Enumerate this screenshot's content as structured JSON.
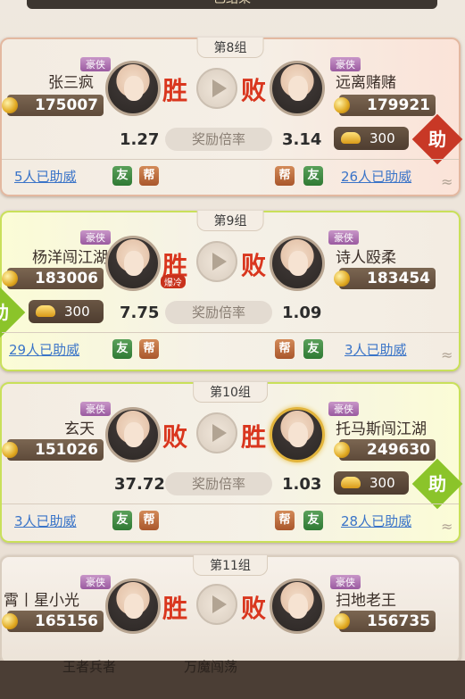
{
  "header": {
    "title": "已结束"
  },
  "common": {
    "rate_label": "奖励倍率",
    "friend_btn": "友",
    "guild_btn": "帮",
    "assist_label": "助",
    "hero_tag": "豪侠"
  },
  "matches": [
    {
      "group": "第8组",
      "left": {
        "name": "张三疯",
        "power": "175007",
        "odds": "1.27",
        "result": "胜",
        "help": "5人已助威"
      },
      "right": {
        "name": "远离赌赌",
        "power": "179921",
        "odds": "3.14",
        "result": "败",
        "help": "26人已助威",
        "bet": "300"
      }
    },
    {
      "group": "第9组",
      "left": {
        "name": "杨洋闯江湖",
        "power": "183006",
        "odds": "7.75",
        "result": "胜",
        "badge": "爆冷",
        "help": "29人已助威",
        "bet": "300"
      },
      "right": {
        "name": "诗人殴柔",
        "power": "183454",
        "odds": "1.09",
        "result": "败",
        "help": "3人已助威"
      }
    },
    {
      "group": "第10组",
      "left": {
        "name": "玄天",
        "power": "151026",
        "odds": "37.72",
        "result": "败",
        "help": "3人已助威"
      },
      "right": {
        "name": "托马斯闯江湖",
        "power": "249630",
        "odds": "1.03",
        "result": "胜",
        "help": "28人已助威",
        "bet": "300"
      }
    },
    {
      "group": "第11组",
      "left": {
        "name": "霄丨星小光",
        "power": "165156",
        "result": "胜"
      },
      "right": {
        "name": "扫地老王",
        "power": "156735",
        "result": "败"
      }
    }
  ],
  "footer": {
    "left_name": "王者兵者",
    "right_name": "万魔闯荡"
  }
}
